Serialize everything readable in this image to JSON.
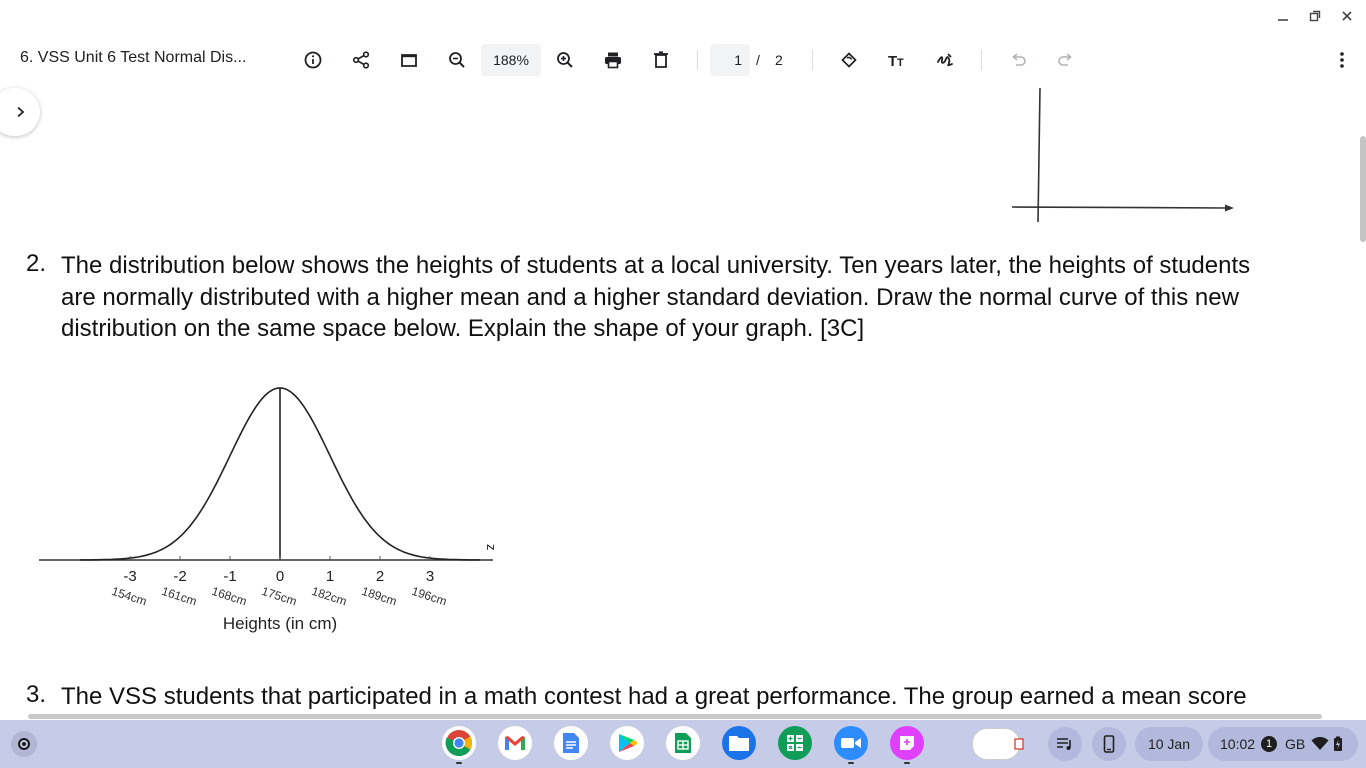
{
  "window": {
    "minimize_icon": "minimize-icon",
    "restore_icon": "restore-icon",
    "close_icon": "close-icon"
  },
  "toolbar": {
    "title": "6. VSS Unit 6 Test Normal Dis...",
    "zoom": "188%",
    "page_current": "1",
    "page_separator": "/",
    "page_total": "2"
  },
  "document": {
    "q2_number": "2.",
    "q2_line1": "The distribution below shows the heights of students at a local university. Ten years later, the heights of students",
    "q2_line2": "are normally distributed with a higher mean and a higher standard deviation. Draw the normal curve of this new",
    "q2_line3": "distribution on the same space below. Explain the shape of your graph. [3C]",
    "q3_number": "3.",
    "q3_line1": "The VSS students that participated in a math contest had a great performance. The group earned a mean score"
  },
  "chart_data": {
    "type": "line",
    "title": "",
    "xlabel": "Heights (in cm)",
    "z_label": "z",
    "z_ticks": [
      "-3",
      "-2",
      "-1",
      "0",
      "1",
      "2",
      "3"
    ],
    "height_ticks": [
      "154cm",
      "161cm",
      "168cm",
      "175cm",
      "182cm",
      "189cm",
      "196cm"
    ],
    "mean": 175,
    "sd": 7,
    "series": [
      {
        "values_z": [
          -4,
          4
        ]
      }
    ]
  },
  "shelf": {
    "date": "10 Jan",
    "time": "10:02",
    "notification_count": "1",
    "ime": "GB"
  },
  "colors": {
    "shelf_bg": "#c6cbe8",
    "tray_pill": "#b3b9dc"
  }
}
